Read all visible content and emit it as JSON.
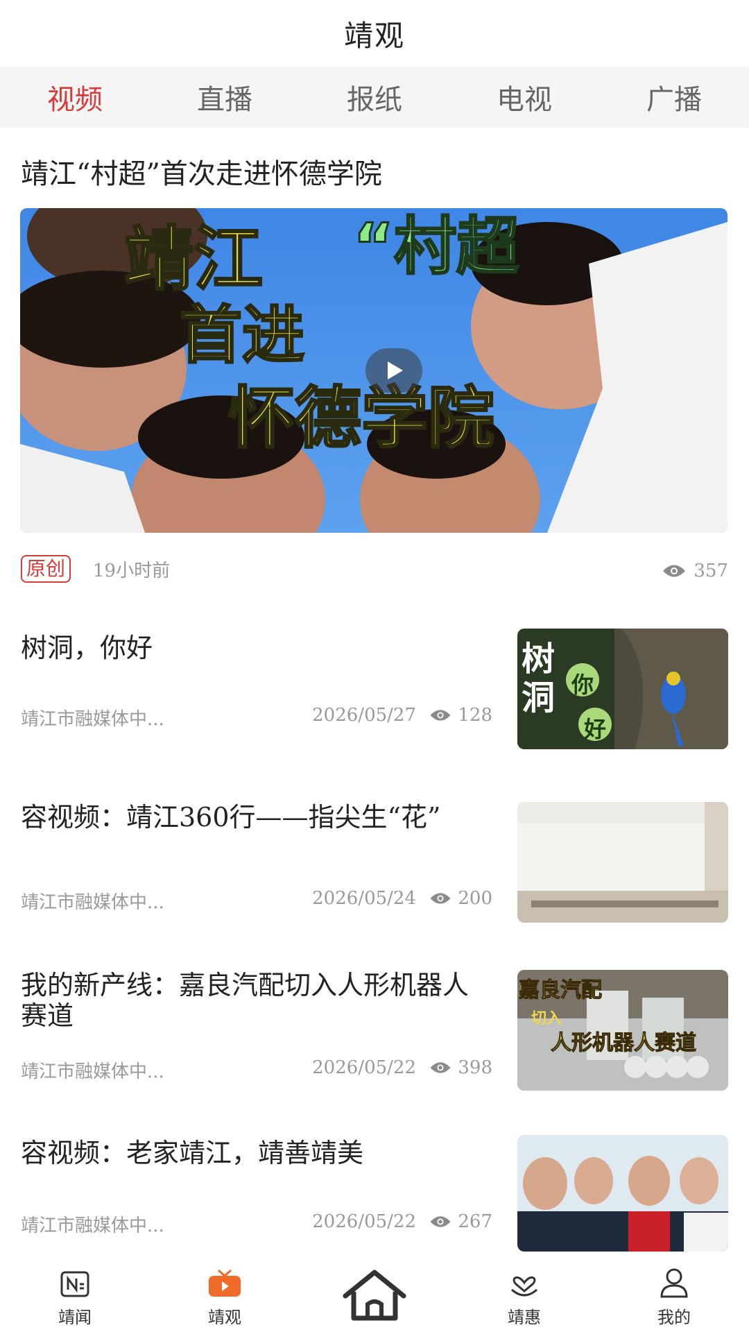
{
  "header": {
    "title": "靖观"
  },
  "tabs": [
    {
      "label": "视频",
      "active": true
    },
    {
      "label": "直播",
      "active": false
    },
    {
      "label": "报纸",
      "active": false
    },
    {
      "label": "电视",
      "active": false
    },
    {
      "label": "广播",
      "active": false
    }
  ],
  "featured": {
    "title": "靖江“村超”首次走进怀德学院",
    "image_text": [
      "靖江",
      "“村超",
      "首进",
      "怀德学院"
    ],
    "badge": "原创",
    "time_ago": "19小时前",
    "views": "357"
  },
  "news": [
    {
      "title": "树洞，你好",
      "source": "靖江市融媒体中...",
      "date": "2026/05/27",
      "views": "128",
      "thumb_text": [
        "树",
        "洞",
        "你",
        "好"
      ]
    },
    {
      "title": "容视频：靖江360行——指尖生“花”",
      "source": "靖江市融媒体中...",
      "date": "2026/05/24",
      "views": "200"
    },
    {
      "title": "我的新产线：嘉良汽配切入人形机器人赛道",
      "source": "靖江市融媒体中...",
      "date": "2026/05/22",
      "views": "398",
      "thumb_text": [
        "嘉良汽配",
        "切入",
        "人形机器人赛道"
      ]
    },
    {
      "title": "容视频：老家靖江，靖善靖美",
      "source": "靖江市融媒体中...",
      "date": "2026/05/22",
      "views": "267"
    }
  ],
  "bottom_nav": [
    {
      "label": "靖闻",
      "icon": "newspaper-icon"
    },
    {
      "label": "靖观",
      "icon": "tv-icon",
      "active": true
    },
    {
      "label": "",
      "icon": "home-icon"
    },
    {
      "label": "靖惠",
      "icon": "heart-hand-icon"
    },
    {
      "label": "我的",
      "icon": "user-icon"
    }
  ],
  "colors": {
    "accent": "#d93a3a",
    "tab_bg": "#f5f5f5",
    "muted": "#999999",
    "nav_orange": "#f06a2a"
  }
}
